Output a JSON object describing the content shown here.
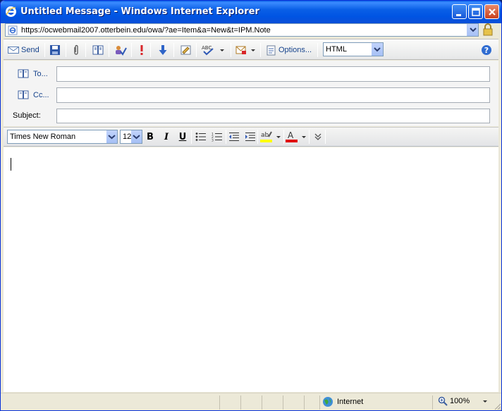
{
  "window": {
    "title": "Untitled Message - Windows Internet Explorer"
  },
  "address": {
    "url": "https://ocwebmail2007.otterbein.edu/owa/?ae=Item&a=New&t=IPM.Note"
  },
  "toolbar": {
    "send_label": "Send",
    "options_label": "Options...",
    "format_value": "HTML"
  },
  "fields": {
    "to_label": "To...",
    "cc_label": "Cc...",
    "subject_label": "Subject:",
    "to_value": "",
    "cc_value": "",
    "subject_value": ""
  },
  "formatting": {
    "font_value": "Times New Roman",
    "size_value": "12",
    "bold": "B",
    "italic": "I",
    "underline": "U",
    "highlight_glyph": "ab",
    "font_color_glyph": "A"
  },
  "body": {
    "text": ""
  },
  "status": {
    "zone": "Internet",
    "zoom": "100%"
  },
  "colors": {
    "titlebar": "#0054e3",
    "link_blue": "#15428b",
    "font_color_bar": "#e00000",
    "highlight_bar": "#ffff00"
  }
}
